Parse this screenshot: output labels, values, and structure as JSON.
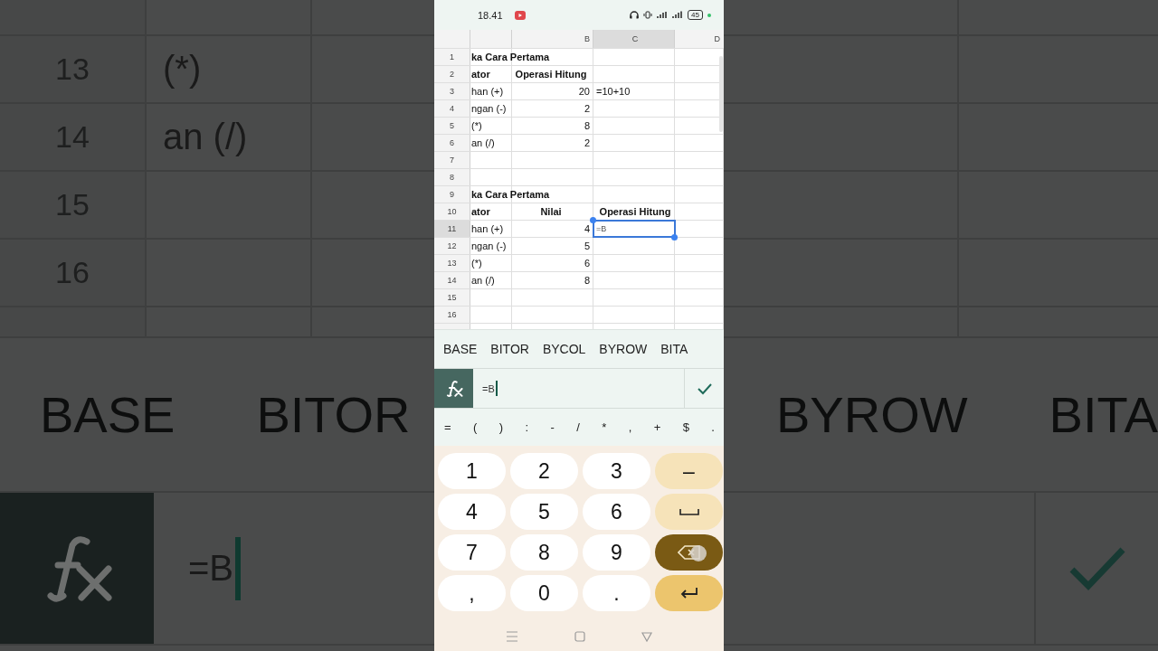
{
  "backdrop_left": {
    "rows": [
      {
        "number": "13",
        "text": "(*)"
      },
      {
        "number": "14",
        "text": "an (/)"
      },
      {
        "number": "15"
      },
      {
        "number": "16"
      }
    ],
    "suggestions": [
      "BASE",
      "BITOR"
    ],
    "formula": "=B"
  },
  "backdrop_right": {
    "suggestions": [
      "BYROW",
      "BITA"
    ]
  },
  "status_bar": {
    "time": "18.41",
    "battery": "45"
  },
  "sheet": {
    "columns": [
      {
        "label": "B",
        "selected": false
      },
      {
        "label": "C",
        "selected": true
      },
      {
        "label": "D",
        "selected": false
      }
    ],
    "rows": [
      {
        "number": "1",
        "selected": false,
        "bold": true,
        "a": "ka Cara Pertama"
      },
      {
        "number": "2",
        "selected": false,
        "bold": true,
        "a": "ator",
        "b": "Operasi Hitung"
      },
      {
        "number": "3",
        "selected": false,
        "bold": false,
        "a": "han (+)",
        "b": "20",
        "c": "=10+10"
      },
      {
        "number": "4",
        "selected": false,
        "bold": false,
        "a": "ngan (-)",
        "b": "2"
      },
      {
        "number": "5",
        "selected": false,
        "bold": false,
        "a": "(*)",
        "b": "8"
      },
      {
        "number": "6",
        "selected": false,
        "bold": false,
        "a": "an (/)",
        "b": "2"
      },
      {
        "number": "7",
        "selected": false
      },
      {
        "number": "8",
        "selected": false
      },
      {
        "number": "9",
        "selected": false,
        "bold": true,
        "a": "ka Cara Pertama"
      },
      {
        "number": "10",
        "selected": false,
        "bold": true,
        "a": "ator",
        "b": "Nilai",
        "c": "Operasi Hitung"
      },
      {
        "number": "11",
        "selected": true,
        "bold": false,
        "a": "han (+)",
        "b": "4",
        "c": "=B"
      },
      {
        "number": "12",
        "selected": false,
        "bold": false,
        "a": "ngan (-)",
        "b": "5"
      },
      {
        "number": "13",
        "selected": false,
        "bold": false,
        "a": "(*)",
        "b": "6"
      },
      {
        "number": "14",
        "selected": false,
        "bold": false,
        "a": "an (/)",
        "b": "8"
      },
      {
        "number": "15",
        "selected": false
      },
      {
        "number": "16",
        "selected": false
      }
    ]
  },
  "suggestions": [
    "BASE",
    "BITOR",
    "BYCOL",
    "BYROW",
    "BITA"
  ],
  "formula_bar": {
    "value": "=B"
  },
  "symbols": [
    "=",
    "(",
    ")",
    ":",
    "-",
    "/",
    "*",
    ",",
    "+",
    "$",
    "."
  ],
  "keypad": [
    {
      "kind": "digit",
      "label": "1"
    },
    {
      "kind": "digit",
      "label": "2"
    },
    {
      "kind": "digit",
      "label": "3"
    },
    {
      "kind": "minus",
      "label": "–"
    },
    {
      "kind": "digit",
      "label": "4"
    },
    {
      "kind": "digit",
      "label": "5"
    },
    {
      "kind": "digit",
      "label": "6"
    },
    {
      "kind": "space"
    },
    {
      "kind": "digit",
      "label": "7"
    },
    {
      "kind": "digit",
      "label": "8"
    },
    {
      "kind": "digit",
      "label": "9"
    },
    {
      "kind": "backspace"
    },
    {
      "kind": "digit",
      "label": ","
    },
    {
      "kind": "digit",
      "label": "0"
    },
    {
      "kind": "digit",
      "label": "."
    },
    {
      "kind": "enter"
    }
  ]
}
